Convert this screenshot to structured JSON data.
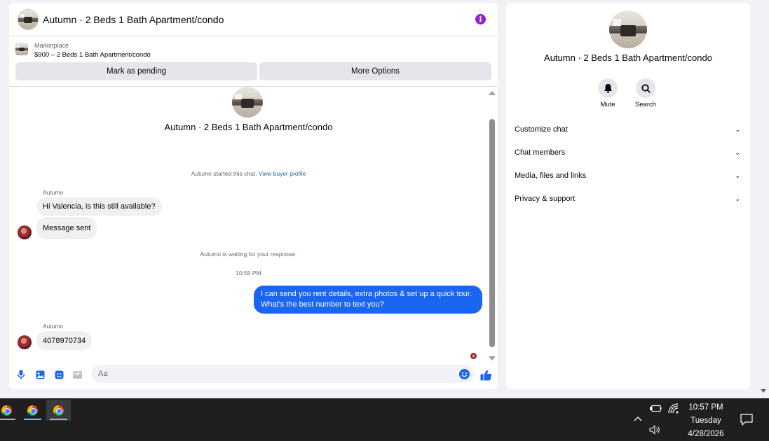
{
  "chat": {
    "header_title": "Autumn · 2 Beds 1 Bath Apartment/condo",
    "info_icon": "info-icon",
    "info_color": "#9b1bd8",
    "marketplace_label": "Marketplace",
    "listing": "$900 – 2 Beds 1 Bath Apartment/condo",
    "mark_pending_label": "Mark as pending",
    "more_options_label": "More Options",
    "convo_title": "Autumn · 2 Beds 1 Bath Apartment/condo",
    "started_text": "Autumn started this chat.",
    "view_profile_link": "View buyer profile",
    "sender_1": "Autumn",
    "msg_1": "Hi Valencia, is this still available?",
    "msg_2": "Message sent",
    "waiting_text": "Autumn is waiting for your response.",
    "timestamp": "10:55 PM",
    "msg_out_line1": "I can send you rent details, extra photos & set up a quick tour.",
    "msg_out_line2": "What's the best number to text you?",
    "sender_2": "Autumn",
    "msg_3": "4078970734",
    "composer_placeholder": "Aa",
    "accent_color": "#1a66f0",
    "gif_label": "GIF"
  },
  "right_panel": {
    "title": "Autumn · 2 Beds 1 Bath Apartment/condo",
    "mute_label": "Mute",
    "search_label": "Search",
    "items": [
      {
        "label": "Customize chat"
      },
      {
        "label": "Chat members"
      },
      {
        "label": "Media, files and links"
      },
      {
        "label": "Privacy & support"
      }
    ]
  },
  "taskbar": {
    "time": "10:57 PM",
    "day": "Tuesday",
    "date": "4/28/2026"
  }
}
